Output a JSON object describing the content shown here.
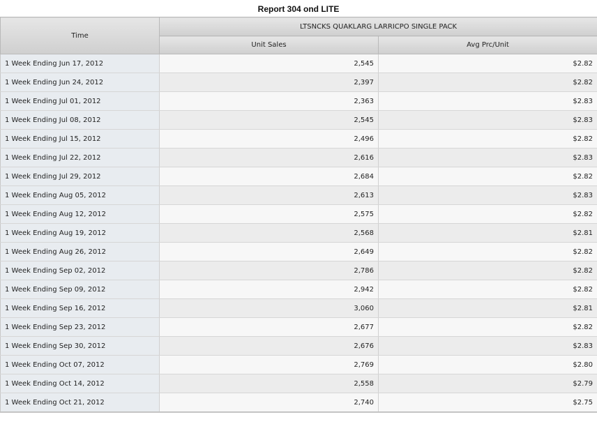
{
  "report": {
    "title": "Report 304 ond LITE"
  },
  "table": {
    "time_header": "Time",
    "group_header": "LTSNCKS QUAKLARG LARRICPO SINGLE PACK",
    "columns": [
      "Unit Sales",
      "Avg Prc/Unit"
    ],
    "rows": [
      {
        "time": "1 Week Ending Jun 17, 2012",
        "unit_sales": "2,545",
        "avg_price": "$2.82"
      },
      {
        "time": "1 Week Ending Jun 24, 2012",
        "unit_sales": "2,397",
        "avg_price": "$2.82"
      },
      {
        "time": "1 Week Ending Jul 01, 2012",
        "unit_sales": "2,363",
        "avg_price": "$2.83"
      },
      {
        "time": "1 Week Ending Jul 08, 2012",
        "unit_sales": "2,545",
        "avg_price": "$2.83"
      },
      {
        "time": "1 Week Ending Jul 15, 2012",
        "unit_sales": "2,496",
        "avg_price": "$2.82"
      },
      {
        "time": "1 Week Ending Jul 22, 2012",
        "unit_sales": "2,616",
        "avg_price": "$2.83"
      },
      {
        "time": "1 Week Ending Jul 29, 2012",
        "unit_sales": "2,684",
        "avg_price": "$2.82"
      },
      {
        "time": "1 Week Ending Aug 05, 2012",
        "unit_sales": "2,613",
        "avg_price": "$2.83"
      },
      {
        "time": "1 Week Ending Aug 12, 2012",
        "unit_sales": "2,575",
        "avg_price": "$2.82"
      },
      {
        "time": "1 Week Ending Aug 19, 2012",
        "unit_sales": "2,568",
        "avg_price": "$2.81"
      },
      {
        "time": "1 Week Ending Aug 26, 2012",
        "unit_sales": "2,649",
        "avg_price": "$2.82"
      },
      {
        "time": "1 Week Ending Sep 02, 2012",
        "unit_sales": "2,786",
        "avg_price": "$2.82"
      },
      {
        "time": "1 Week Ending Sep 09, 2012",
        "unit_sales": "2,942",
        "avg_price": "$2.82"
      },
      {
        "time": "1 Week Ending Sep 16, 2012",
        "unit_sales": "3,060",
        "avg_price": "$2.81"
      },
      {
        "time": "1 Week Ending Sep 23, 2012",
        "unit_sales": "2,677",
        "avg_price": "$2.82"
      },
      {
        "time": "1 Week Ending Sep 30, 2012",
        "unit_sales": "2,676",
        "avg_price": "$2.83"
      },
      {
        "time": "1 Week Ending Oct 07, 2012",
        "unit_sales": "2,769",
        "avg_price": "$2.80"
      },
      {
        "time": "1 Week Ending Oct 14, 2012",
        "unit_sales": "2,558",
        "avg_price": "$2.79"
      },
      {
        "time": "1 Week Ending Oct 21, 2012",
        "unit_sales": "2,740",
        "avg_price": "$2.75"
      }
    ]
  }
}
